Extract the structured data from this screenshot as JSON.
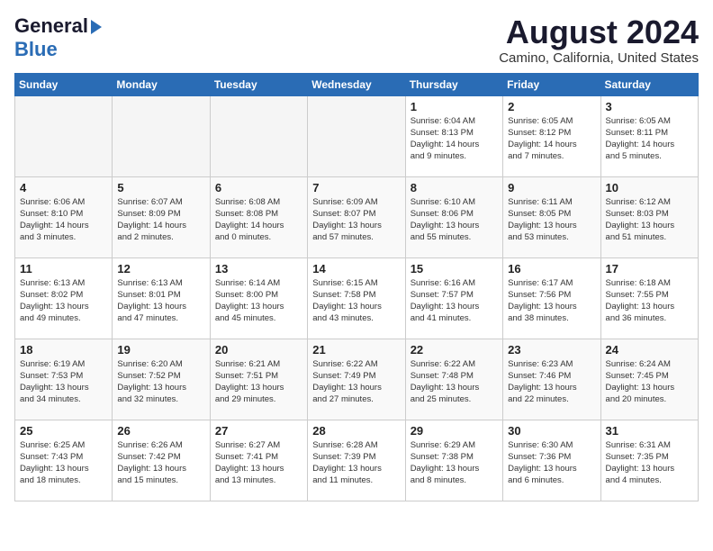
{
  "logo": {
    "line1": "General",
    "line2": "Blue"
  },
  "title": "August 2024",
  "location": "Camino, California, United States",
  "days_of_week": [
    "Sunday",
    "Monday",
    "Tuesday",
    "Wednesday",
    "Thursday",
    "Friday",
    "Saturday"
  ],
  "weeks": [
    [
      {
        "day": "",
        "info": "",
        "empty": true
      },
      {
        "day": "",
        "info": "",
        "empty": true
      },
      {
        "day": "",
        "info": "",
        "empty": true
      },
      {
        "day": "",
        "info": "",
        "empty": true
      },
      {
        "day": "1",
        "info": "Sunrise: 6:04 AM\nSunset: 8:13 PM\nDaylight: 14 hours\nand 9 minutes.",
        "empty": false
      },
      {
        "day": "2",
        "info": "Sunrise: 6:05 AM\nSunset: 8:12 PM\nDaylight: 14 hours\nand 7 minutes.",
        "empty": false
      },
      {
        "day": "3",
        "info": "Sunrise: 6:05 AM\nSunset: 8:11 PM\nDaylight: 14 hours\nand 5 minutes.",
        "empty": false
      }
    ],
    [
      {
        "day": "4",
        "info": "Sunrise: 6:06 AM\nSunset: 8:10 PM\nDaylight: 14 hours\nand 3 minutes.",
        "empty": false
      },
      {
        "day": "5",
        "info": "Sunrise: 6:07 AM\nSunset: 8:09 PM\nDaylight: 14 hours\nand 2 minutes.",
        "empty": false
      },
      {
        "day": "6",
        "info": "Sunrise: 6:08 AM\nSunset: 8:08 PM\nDaylight: 14 hours\nand 0 minutes.",
        "empty": false
      },
      {
        "day": "7",
        "info": "Sunrise: 6:09 AM\nSunset: 8:07 PM\nDaylight: 13 hours\nand 57 minutes.",
        "empty": false
      },
      {
        "day": "8",
        "info": "Sunrise: 6:10 AM\nSunset: 8:06 PM\nDaylight: 13 hours\nand 55 minutes.",
        "empty": false
      },
      {
        "day": "9",
        "info": "Sunrise: 6:11 AM\nSunset: 8:05 PM\nDaylight: 13 hours\nand 53 minutes.",
        "empty": false
      },
      {
        "day": "10",
        "info": "Sunrise: 6:12 AM\nSunset: 8:03 PM\nDaylight: 13 hours\nand 51 minutes.",
        "empty": false
      }
    ],
    [
      {
        "day": "11",
        "info": "Sunrise: 6:13 AM\nSunset: 8:02 PM\nDaylight: 13 hours\nand 49 minutes.",
        "empty": false
      },
      {
        "day": "12",
        "info": "Sunrise: 6:13 AM\nSunset: 8:01 PM\nDaylight: 13 hours\nand 47 minutes.",
        "empty": false
      },
      {
        "day": "13",
        "info": "Sunrise: 6:14 AM\nSunset: 8:00 PM\nDaylight: 13 hours\nand 45 minutes.",
        "empty": false
      },
      {
        "day": "14",
        "info": "Sunrise: 6:15 AM\nSunset: 7:58 PM\nDaylight: 13 hours\nand 43 minutes.",
        "empty": false
      },
      {
        "day": "15",
        "info": "Sunrise: 6:16 AM\nSunset: 7:57 PM\nDaylight: 13 hours\nand 41 minutes.",
        "empty": false
      },
      {
        "day": "16",
        "info": "Sunrise: 6:17 AM\nSunset: 7:56 PM\nDaylight: 13 hours\nand 38 minutes.",
        "empty": false
      },
      {
        "day": "17",
        "info": "Sunrise: 6:18 AM\nSunset: 7:55 PM\nDaylight: 13 hours\nand 36 minutes.",
        "empty": false
      }
    ],
    [
      {
        "day": "18",
        "info": "Sunrise: 6:19 AM\nSunset: 7:53 PM\nDaylight: 13 hours\nand 34 minutes.",
        "empty": false
      },
      {
        "day": "19",
        "info": "Sunrise: 6:20 AM\nSunset: 7:52 PM\nDaylight: 13 hours\nand 32 minutes.",
        "empty": false
      },
      {
        "day": "20",
        "info": "Sunrise: 6:21 AM\nSunset: 7:51 PM\nDaylight: 13 hours\nand 29 minutes.",
        "empty": false
      },
      {
        "day": "21",
        "info": "Sunrise: 6:22 AM\nSunset: 7:49 PM\nDaylight: 13 hours\nand 27 minutes.",
        "empty": false
      },
      {
        "day": "22",
        "info": "Sunrise: 6:22 AM\nSunset: 7:48 PM\nDaylight: 13 hours\nand 25 minutes.",
        "empty": false
      },
      {
        "day": "23",
        "info": "Sunrise: 6:23 AM\nSunset: 7:46 PM\nDaylight: 13 hours\nand 22 minutes.",
        "empty": false
      },
      {
        "day": "24",
        "info": "Sunrise: 6:24 AM\nSunset: 7:45 PM\nDaylight: 13 hours\nand 20 minutes.",
        "empty": false
      }
    ],
    [
      {
        "day": "25",
        "info": "Sunrise: 6:25 AM\nSunset: 7:43 PM\nDaylight: 13 hours\nand 18 minutes.",
        "empty": false
      },
      {
        "day": "26",
        "info": "Sunrise: 6:26 AM\nSunset: 7:42 PM\nDaylight: 13 hours\nand 15 minutes.",
        "empty": false
      },
      {
        "day": "27",
        "info": "Sunrise: 6:27 AM\nSunset: 7:41 PM\nDaylight: 13 hours\nand 13 minutes.",
        "empty": false
      },
      {
        "day": "28",
        "info": "Sunrise: 6:28 AM\nSunset: 7:39 PM\nDaylight: 13 hours\nand 11 minutes.",
        "empty": false
      },
      {
        "day": "29",
        "info": "Sunrise: 6:29 AM\nSunset: 7:38 PM\nDaylight: 13 hours\nand 8 minutes.",
        "empty": false
      },
      {
        "day": "30",
        "info": "Sunrise: 6:30 AM\nSunset: 7:36 PM\nDaylight: 13 hours\nand 6 minutes.",
        "empty": false
      },
      {
        "day": "31",
        "info": "Sunrise: 6:31 AM\nSunset: 7:35 PM\nDaylight: 13 hours\nand 4 minutes.",
        "empty": false
      }
    ]
  ]
}
